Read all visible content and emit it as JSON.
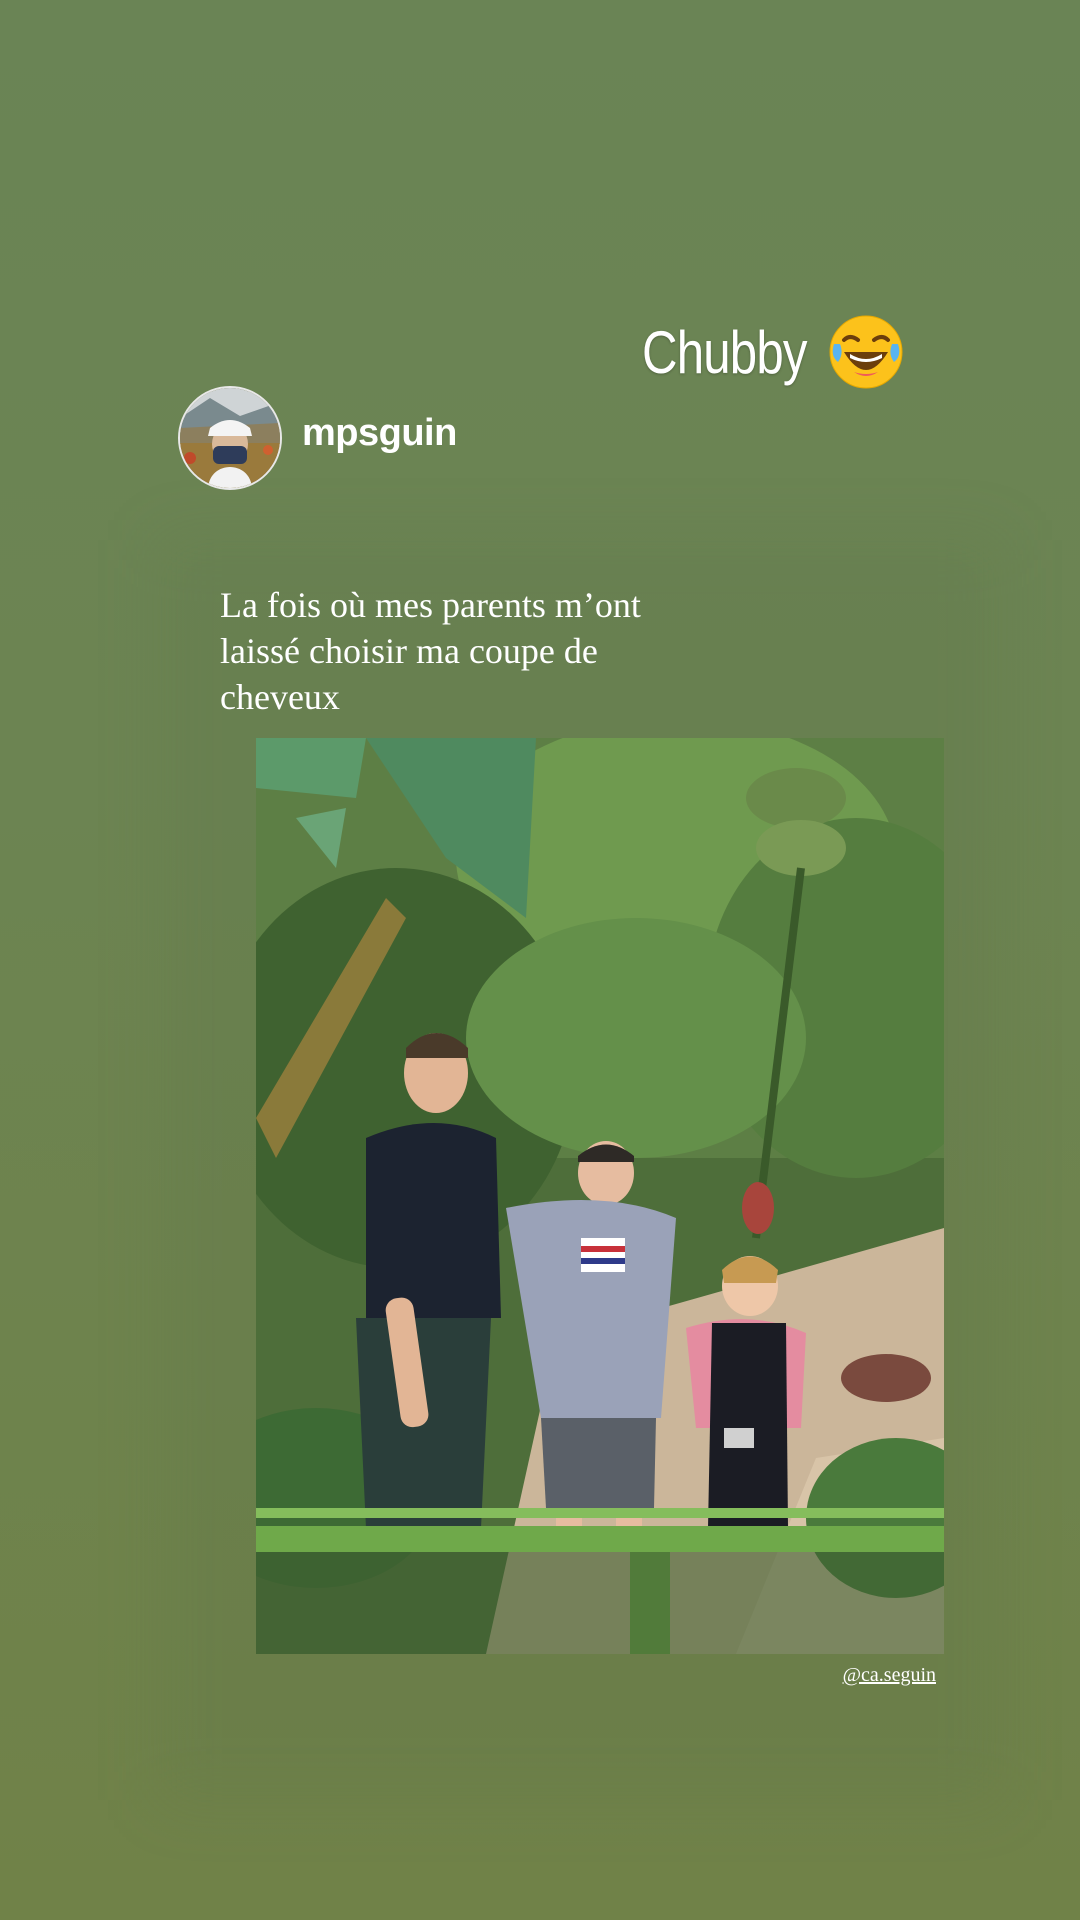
{
  "story": {
    "caption": "Chubby",
    "emoji": "tears-of-joy-emoji",
    "background_color": "#6b8152"
  },
  "shared_post": {
    "username": "mpsguin",
    "avatar_icon": "profile-avatar",
    "text": "La fois où mes parents m’ont laissé choisir ma coupe de cheveux",
    "photo_subject": "family-photo",
    "credit": "@ca.seguin"
  }
}
